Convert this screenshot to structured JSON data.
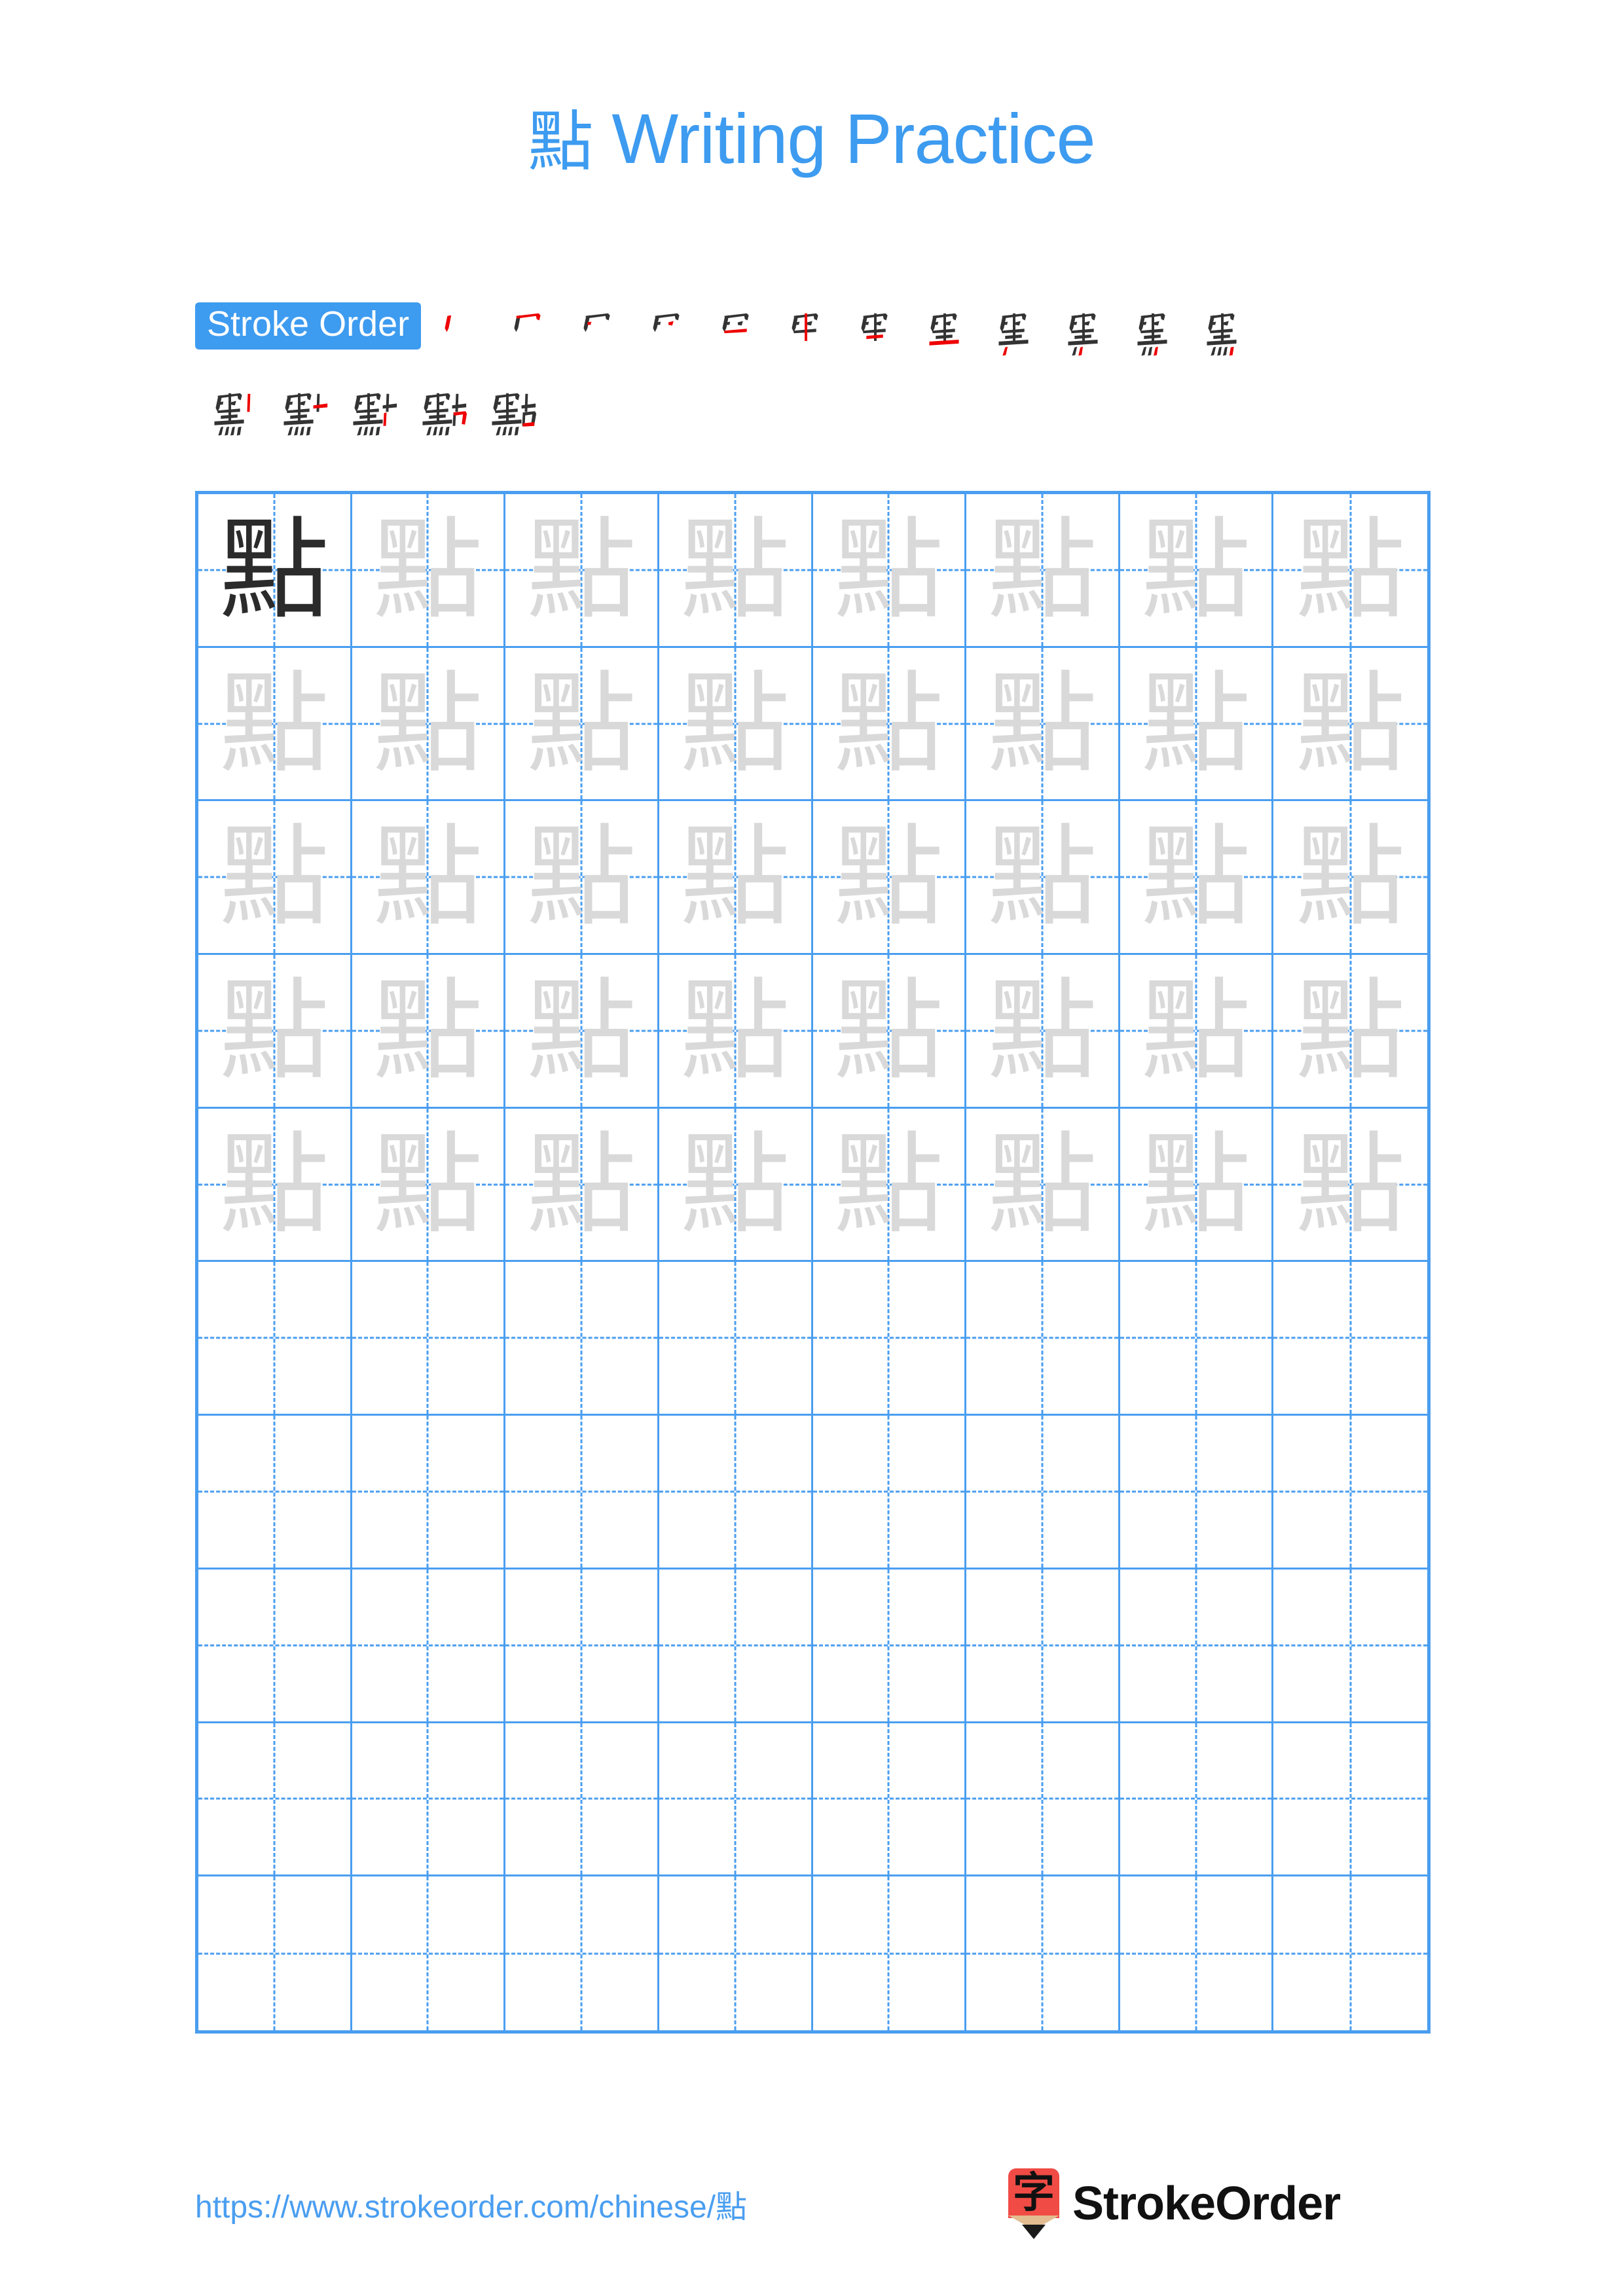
{
  "page": {
    "character": "點",
    "title": "點 Writing Practice",
    "title_character": "點",
    "title_suffix": " Writing Practice",
    "accent_color": "#3d9bf0",
    "grid_line_color": "#4a9ef0",
    "trace_color": "#d9d9d9",
    "model_color": "#2b2b2b",
    "stroke_done_color": "#333333",
    "stroke_current_color": "#ee0000",
    "background_color": "#ffffff"
  },
  "stroke_order": {
    "badge_label": "Stroke Order",
    "total_strokes": 17,
    "row1_count": 12,
    "row2_count": 5,
    "steps": [
      {
        "index": 1,
        "partial": "丨"
      },
      {
        "index": 2,
        "partial": "冂"
      },
      {
        "index": 3,
        "partial": "冃"
      },
      {
        "index": 4,
        "partial": "冊"
      },
      {
        "index": 5,
        "partial": "四"
      },
      {
        "index": 6,
        "partial": "甲"
      },
      {
        "index": 7,
        "partial": "甲"
      },
      {
        "index": 8,
        "partial": "里"
      },
      {
        "index": 9,
        "partial": "里"
      },
      {
        "index": 10,
        "partial": "黒"
      },
      {
        "index": 11,
        "partial": "黑"
      },
      {
        "index": 12,
        "partial": "黑"
      },
      {
        "index": 13,
        "partial": "黑丨"
      },
      {
        "index": 14,
        "partial": "點"
      },
      {
        "index": 15,
        "partial": "點"
      },
      {
        "index": 16,
        "partial": "點"
      },
      {
        "index": 17,
        "partial": "點"
      }
    ]
  },
  "practice_grid": {
    "columns": 8,
    "rows": 10,
    "model_cell": {
      "row": 1,
      "col": 1,
      "char": "點"
    },
    "traced_rows": 5,
    "blank_rows": 5,
    "cell_char": "點"
  },
  "footer": {
    "url": "https://www.strokeorder.com/chinese/點",
    "logo_glyph": "字",
    "logo_text": "StrokeOrder"
  }
}
